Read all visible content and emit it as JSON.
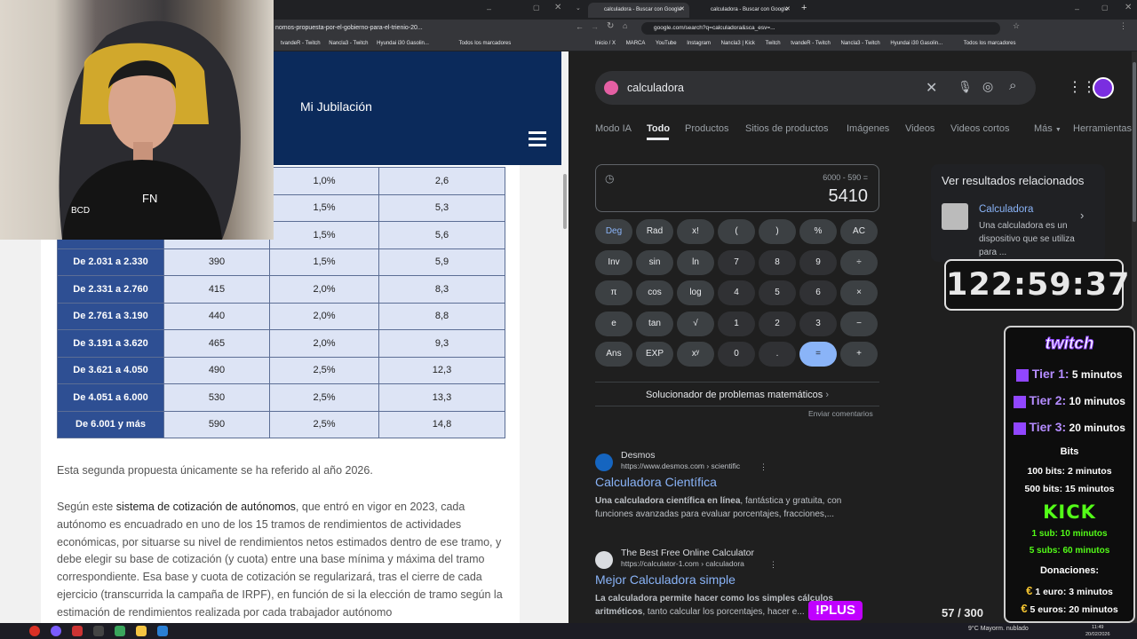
{
  "left_window": {
    "url": "nomos-propuesta-por-el-gobierno-para-el-trienio-20...",
    "bookmarks": [
      "tvandeR - Twitch",
      "Nancla3 - Twitch",
      "Hyundai i30 Gasolin...",
      "Todos los marcadores"
    ],
    "site_title": "Mi Jubilación",
    "table": {
      "rows": [
        [
          "",
          "",
          "1,0%",
          "2,6"
        ],
        [
          "",
          "",
          "1,5%",
          "5,3"
        ],
        [
          "",
          "",
          "1,5%",
          "5,6"
        ],
        [
          "De 2.031 a 2.330",
          "390",
          "1,5%",
          "5,9"
        ],
        [
          "De 2.331 a 2.760",
          "415",
          "2,0%",
          "8,3"
        ],
        [
          "De 2.761 a 3.190",
          "440",
          "2,0%",
          "8,8"
        ],
        [
          "De 3.191 a 3.620",
          "465",
          "2,0%",
          "9,3"
        ],
        [
          "De 3.621 a 4.050",
          "490",
          "2,5%",
          "12,3"
        ],
        [
          "De 4.051 a 6.000",
          "530",
          "2,5%",
          "13,3"
        ],
        [
          "De 6.001 y más",
          "590",
          "2,5%",
          "14,8"
        ]
      ]
    },
    "paragraph1": "Esta segunda propuesta únicamente se ha referido al año 2026.",
    "paragraph2_prefix": "Según este ",
    "paragraph2_link": "sistema de cotización de autónomos",
    "paragraph2_rest": ", que entró en vigor en 2023, cada autónomo es encuadrado en uno de los 15 tramos de rendimientos de actividades económicas, por situarse su nivel de rendimientos netos estimados dentro de ese tramo, y debe elegir su base de cotización (y cuota) entre una base mínima y máxima del tramo correspondiente. Esa base y cuota de cotización se regularizará, tras el cierre de cada ejercicio (transcurrida la campaña de IRPF), en función de si la elección de tramo según la estimación de rendimientos realizada por cada trabajador autónomo"
  },
  "right_window": {
    "tabs": [
      "calculadora - Buscar con Google",
      "calculadora - Buscar con Google"
    ],
    "url": "google.com/search?q=calculadora&sca_esv=...",
    "bookmarks": [
      "Inicio / X",
      "MARCA",
      "YouTube",
      "Instagram",
      "Nancla3 | Kick",
      "Twitch",
      "tvandeR - Twitch",
      "Nancla3 - Twitch",
      "Hyundai i30 Gasolin...",
      "Todos los marcadores"
    ],
    "search_query": "calculadora",
    "nav_tabs": [
      "Modo IA",
      "Todo",
      "Productos",
      "Sitios de productos",
      "Imágenes",
      "Videos",
      "Videos cortos",
      "Más",
      "Herramientas"
    ],
    "calculator": {
      "expression": "6000 - 590 =",
      "result": "5410",
      "keys": [
        [
          "Deg",
          "Rad",
          "x!",
          "(",
          ")",
          "%",
          "AC"
        ],
        [
          "Inv",
          "sin",
          "ln",
          "7",
          "8",
          "9",
          "÷"
        ],
        [
          "π",
          "cos",
          "log",
          "4",
          "5",
          "6",
          "×"
        ],
        [
          "e",
          "tan",
          "√",
          "1",
          "2",
          "3",
          "−"
        ],
        [
          "Ans",
          "EXP",
          "xʸ",
          "0",
          ".",
          "=",
          "+"
        ]
      ]
    },
    "solver_label": "Solucionador de problemas matemáticos",
    "feedback_label": "Enviar comentarios",
    "results": [
      {
        "site": "Desmos",
        "url": "https://www.desmos.com › scientific",
        "title": "Calculadora Científica",
        "snippet_bold": "Una calculadora científica en línea",
        "snippet": ", fantástica y gratuita, con funciones avanzadas para evaluar porcentajes, fracciones,..."
      },
      {
        "site": "The Best Free Online Calculator",
        "url": "https://calculator-1.com › calculadora",
        "title": "Mejor Calculadora simple",
        "snippet_bold": "La calculadora permite hacer como los simples cálculos aritméticos",
        "snippet": ", tanto calcular los porcentajes, hacer e..."
      }
    ],
    "related": {
      "heading": "Ver resultados relacionados",
      "title": "Calculadora",
      "desc": "Una calculadora es un dispositivo que se utiliza para ..."
    }
  },
  "overlay": {
    "timer": "122:59:37",
    "twitch_logo": "twitch",
    "tiers": [
      {
        "label": "Tier 1:",
        "value": "5 minutos"
      },
      {
        "label": "Tier 2:",
        "value": "10 minutos"
      },
      {
        "label": "Tier 3:",
        "value": "20 minutos"
      }
    ],
    "bits_heading": "Bits",
    "bits": [
      "100 bits: 2 minutos",
      "500 bits: 15 minutos"
    ],
    "kick_logo": "KICK",
    "kick": [
      "1 sub: 10 minutos",
      "5 subs: 60 minutos"
    ],
    "donations_heading": "Donaciones:",
    "donations": [
      "1 euro: 3 minutos",
      "5 euros: 20 minutos"
    ],
    "plus_badge": "!PLUS",
    "counter": "57 / 300"
  },
  "taskbar": {
    "weather": "9°C  Mayorm. nublado",
    "time": "11:49",
    "date": "20/02/2026"
  },
  "colors": {
    "site_header": "#0b2a5b",
    "table_header": "#2e4f93",
    "table_cell": "#dde4f5",
    "google_link": "#8ab4f8",
    "twitch": "#9146ff",
    "kick": "#53fc18"
  }
}
